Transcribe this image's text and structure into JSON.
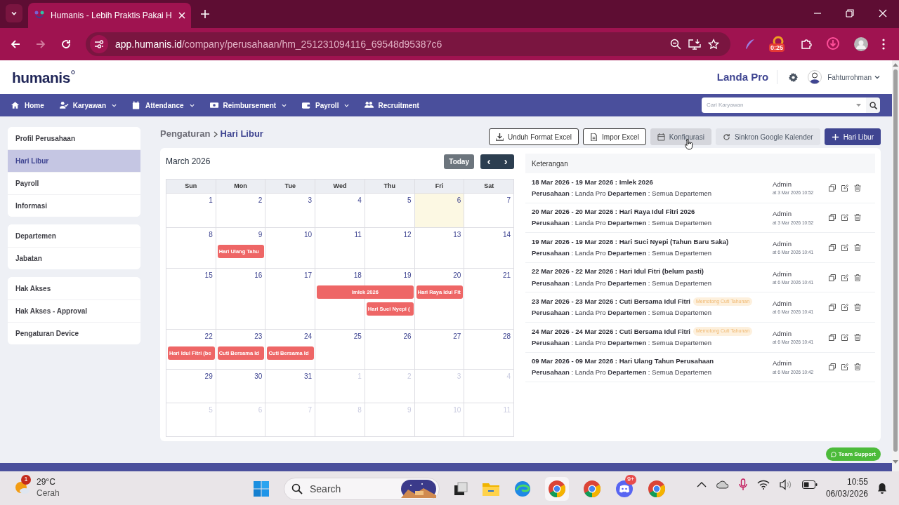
{
  "browser": {
    "tab_title": "Humanis - Lebih Praktis Pakai H",
    "url_host": "app.humanis.id",
    "url_path": "/company/perusahaan/hm_251231094116_69548d95387c6",
    "extension_badge": "0:25"
  },
  "header": {
    "logo": "humanis",
    "company": "Landa Pro",
    "user": "Fahturrohman"
  },
  "nav": {
    "items": [
      {
        "label": "Home",
        "has_menu": false
      },
      {
        "label": "Karyawan",
        "has_menu": true
      },
      {
        "label": "Attendance",
        "has_menu": true
      },
      {
        "label": "Reimbursement",
        "has_menu": true
      },
      {
        "label": "Payroll",
        "has_menu": true
      },
      {
        "label": "Recruitment",
        "has_menu": false
      }
    ],
    "search_placeholder": "Cari Karyawan"
  },
  "sidebar": {
    "groups": [
      [
        {
          "label": "Profil Perusahaan",
          "selected": false
        },
        {
          "label": "Hari Libur",
          "selected": true
        },
        {
          "label": "Payroll",
          "selected": false
        },
        {
          "label": "Informasi",
          "selected": false
        }
      ],
      [
        {
          "label": "Departemen",
          "selected": false
        },
        {
          "label": "Jabatan",
          "selected": false
        }
      ],
      [
        {
          "label": "Hak Akses",
          "selected": false
        },
        {
          "label": "Hak Akses - Approval",
          "selected": false
        },
        {
          "label": "Pengaturan Device",
          "selected": false
        }
      ]
    ]
  },
  "breadcrumb": [
    "Pengaturan",
    "Hari Libur"
  ],
  "actions": [
    {
      "label": "Unduh Format Excel",
      "kind": "outline"
    },
    {
      "label": "Impor Excel",
      "kind": "outline"
    },
    {
      "label": "Konfigurasi",
      "kind": "muted"
    },
    {
      "label": "Sinkron Google Kalender",
      "kind": "light"
    },
    {
      "label": "Hari Libur",
      "kind": "primary"
    }
  ],
  "calendar": {
    "title": "March 2026",
    "today_button": "Today",
    "prev": "‹",
    "next": "›",
    "weekdays": [
      "Sun",
      "Mon",
      "Tue",
      "Wed",
      "Thu",
      "Fri",
      "Sat"
    ],
    "weeks": [
      {
        "days": [
          {
            "label": "1",
            "other_month": false,
            "today": false
          },
          {
            "label": "2",
            "other_month": false,
            "today": false
          },
          {
            "label": "3",
            "other_month": false,
            "today": false
          },
          {
            "label": "4",
            "other_month": false,
            "today": false
          },
          {
            "label": "5",
            "other_month": false,
            "today": false
          },
          {
            "label": "6",
            "other_month": false,
            "today": true
          },
          {
            "label": "7",
            "other_month": false,
            "today": false
          }
        ]
      },
      {
        "days": [
          {
            "label": "8",
            "other_month": false,
            "today": false
          },
          {
            "label": "9",
            "other_month": false,
            "today": false,
            "events": [
              {
                "label": "Hari Ulang Tahu",
                "wide": false
              }
            ]
          },
          {
            "label": "10",
            "other_month": false,
            "today": false
          },
          {
            "label": "11",
            "other_month": false,
            "today": false
          },
          {
            "label": "12",
            "other_month": false,
            "today": false
          },
          {
            "label": "13",
            "other_month": false,
            "today": false
          },
          {
            "label": "14",
            "other_month": false,
            "today": false
          }
        ]
      },
      {
        "days": [
          {
            "label": "15",
            "other_month": false,
            "today": false
          },
          {
            "label": "16",
            "other_month": false,
            "today": false
          },
          {
            "label": "17",
            "other_month": false,
            "today": false
          },
          {
            "label": "18",
            "other_month": false,
            "today": false,
            "events": [
              {
                "label": "Imlek 2026",
                "wide": true
              }
            ]
          },
          {
            "label": "19",
            "other_month": false,
            "today": false,
            "events": [
              {
                "label": "Hari Suci Nyepi (",
                "wide": false
              }
            ]
          },
          {
            "label": "20",
            "other_month": false,
            "today": false,
            "events": [
              {
                "label": "Hari Raya Idul Fit",
                "wide": false
              }
            ]
          },
          {
            "label": "21",
            "other_month": false,
            "today": false
          }
        ]
      },
      {
        "days": [
          {
            "label": "22",
            "other_month": false,
            "today": false,
            "events": [
              {
                "label": "Hari Idul Fitri (be",
                "wide": false
              }
            ]
          },
          {
            "label": "23",
            "other_month": false,
            "today": false,
            "events": [
              {
                "label": "Cuti Bersama Id",
                "wide": false
              }
            ]
          },
          {
            "label": "24",
            "other_month": false,
            "today": false,
            "events": [
              {
                "label": "Cuti Bersama Id",
                "wide": false
              }
            ]
          },
          {
            "label": "25",
            "other_month": false,
            "today": false
          },
          {
            "label": "26",
            "other_month": false,
            "today": false
          },
          {
            "label": "27",
            "other_month": false,
            "today": false
          },
          {
            "label": "28",
            "other_month": false,
            "today": false
          }
        ]
      },
      {
        "days": [
          {
            "label": "29",
            "other_month": false,
            "today": false
          },
          {
            "label": "30",
            "other_month": false,
            "today": false
          },
          {
            "label": "31",
            "other_month": false,
            "today": false
          },
          {
            "label": "1",
            "other_month": true,
            "today": false
          },
          {
            "label": "2",
            "other_month": true,
            "today": false
          },
          {
            "label": "3",
            "other_month": true,
            "today": false
          },
          {
            "label": "4",
            "other_month": true,
            "today": false
          }
        ]
      },
      {
        "days": [
          {
            "label": "5",
            "other_month": true,
            "today": false
          },
          {
            "label": "6",
            "other_month": true,
            "today": false
          },
          {
            "label": "7",
            "other_month": true,
            "today": false
          },
          {
            "label": "8",
            "other_month": true,
            "today": false
          },
          {
            "label": "9",
            "other_month": true,
            "today": false
          },
          {
            "label": "10",
            "other_month": true,
            "today": false
          },
          {
            "label": "11",
            "other_month": true,
            "today": false
          }
        ]
      }
    ]
  },
  "holidays": {
    "heading": "Keterangan",
    "items": [
      {
        "title": "18 Mar 2026 - 19 Mar 2026 : Imlek 2026",
        "detail": "**Perusahaan** : Landa Pro **Departemen** : Semua Departemen",
        "author": "Admin",
        "time": "at 3 Mar 2026 10:52"
      },
      {
        "title": "20 Mar 2026 - 20 Mar 2026 : Hari Raya Idul Fitri 2026",
        "detail": "**Perusahaan** : Landa Pro **Departemen** : Semua Departemen",
        "author": "Admin",
        "time": "at 3 Mar 2026 10:52"
      },
      {
        "title": "19 Mar 2026 - 19 Mar 2026 : Hari Suci Nyepi (Tahun Baru Saka)",
        "detail": "**Perusahaan** : Landa Pro **Departemen** : Semua Departemen",
        "author": "Admin",
        "time": "at 6 Mar 2026 10:41"
      },
      {
        "title": "22 Mar 2026 - 22 Mar 2026 : Hari Idul Fitri (belum pasti)",
        "detail": "**Perusahaan** : Landa Pro **Departemen** : Semua Departemen",
        "author": "Admin",
        "time": "at 6 Mar 2026 10:41"
      },
      {
        "title": "23 Mar 2026 - 23 Mar 2026 : Cuti Bersama Idul Fitri",
        "badge": "Memotong Cuti Tahunan",
        "detail": "**Perusahaan** : Landa Pro **Departemen** : Semua Departemen",
        "author": "Admin",
        "time": "at 6 Mar 2026 10:41"
      },
      {
        "title": "24 Mar 2026 - 24 Mar 2026 : Cuti Bersama Idul Fitri",
        "badge": "Memotong Cuti Tahunan",
        "detail": "**Perusahaan** : Landa Pro **Departemen** : Semua Departemen",
        "author": "Admin",
        "time": "at 6 Mar 2026 10:41"
      },
      {
        "title": "09 Mar 2026 - 09 Mar 2026 : Hari Ulang Tahun Perusahaan",
        "detail": "**Perusahaan** : Landa Pro **Departemen** : Semua Departemen",
        "author": "Admin",
        "time": "at 6 Mar 2026 10:42"
      }
    ]
  },
  "support_button": "Team Support",
  "taskbar": {
    "temperature": "29°C",
    "weather": "Cerah",
    "weather_badge": "1",
    "search": "Search",
    "discord_badge": "9+",
    "time": "10:55",
    "date": "06/03/2026"
  }
}
